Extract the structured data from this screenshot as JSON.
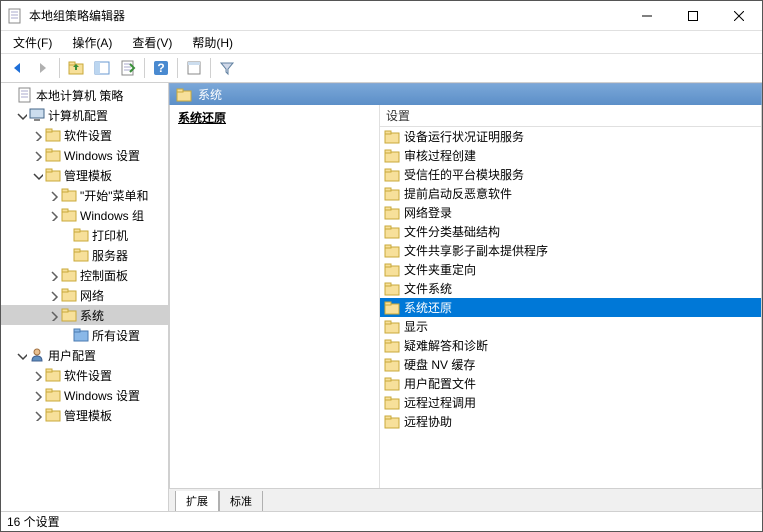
{
  "window": {
    "title": "本地组策略编辑器"
  },
  "menu": {
    "file": "文件(F)",
    "action": "操作(A)",
    "view": "查看(V)",
    "help": "帮助(H)"
  },
  "tree": {
    "root": "本地计算机 策略",
    "computer": "计算机配置",
    "user": "用户配置",
    "software": "软件设置",
    "windows": "Windows 设置",
    "templates": "管理模板",
    "start": "\"开始\"菜单和",
    "wincomp": "Windows 组",
    "printers": "打印机",
    "servers": "服务器",
    "control": "控制面板",
    "network": "网络",
    "system": "系统",
    "all": "所有设置"
  },
  "header": {
    "title": "系统"
  },
  "detail": {
    "heading": "系统还原"
  },
  "list": {
    "column": "设置",
    "items": [
      "设备运行状况证明服务",
      "审核过程创建",
      "受信任的平台模块服务",
      "提前启动反恶意软件",
      "网络登录",
      "文件分类基础结构",
      "文件共享影子副本提供程序",
      "文件夹重定向",
      "文件系统",
      "系统还原",
      "显示",
      "疑难解答和诊断",
      "硬盘 NV 缓存",
      "用户配置文件",
      "远程过程调用",
      "远程协助"
    ],
    "selected": 9
  },
  "tabs": {
    "extended": "扩展",
    "standard": "标准"
  },
  "status": "16 个设置"
}
